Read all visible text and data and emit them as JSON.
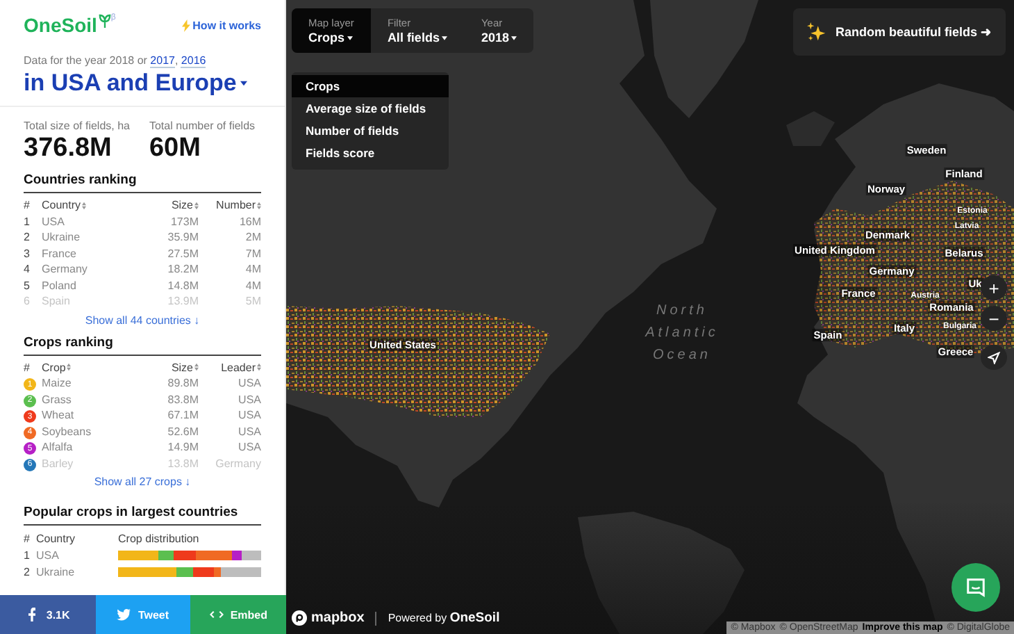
{
  "sidebar": {
    "logo": "OneSoil",
    "logo_mark": "β",
    "help_link": "How it works",
    "year_note": {
      "text": "Data for the year 2018 or",
      "links": [
        "2017",
        "2016"
      ],
      "separator": ","
    },
    "region_title": "in USA and Europe",
    "stats": [
      {
        "label": "Total size of fields, ha",
        "value": "376.8M"
      },
      {
        "label": "Total number of fields",
        "value": "60M"
      }
    ],
    "countries_ranking": {
      "title": "Countries ranking",
      "columns": [
        {
          "label": "#",
          "sortable": false
        },
        {
          "label": "Country",
          "sortable": true
        },
        {
          "label": "Size",
          "sortable": true
        },
        {
          "label": "Number",
          "sortable": true
        }
      ],
      "rows": [
        [
          "1",
          "USA",
          "173M",
          "16M"
        ],
        [
          "2",
          "Ukraine",
          "35.9M",
          "2M"
        ],
        [
          "3",
          "France",
          "27.5M",
          "7M"
        ],
        [
          "4",
          "Germany",
          "18.2M",
          "4M"
        ],
        [
          "5",
          "Poland",
          "14.8M",
          "4M"
        ],
        [
          "6",
          "Spain",
          "13.9M",
          "5M"
        ]
      ],
      "show_all": "Show all 44 countries ↓"
    },
    "crops_ranking": {
      "title": "Crops ranking",
      "columns": [
        {
          "label": "#",
          "sortable": false
        },
        {
          "label": "Crop",
          "sortable": true
        },
        {
          "label": "Size",
          "sortable": true
        },
        {
          "label": "Leader",
          "sortable": true
        }
      ],
      "rows": [
        {
          "rank": "1",
          "name": "Maize",
          "size": "89.8M",
          "leader": "USA",
          "color": "#f2b619"
        },
        {
          "rank": "2",
          "name": "Grass",
          "size": "83.8M",
          "leader": "USA",
          "color": "#5bbf4f"
        },
        {
          "rank": "3",
          "name": "Wheat",
          "size": "67.1M",
          "leader": "USA",
          "color": "#ef3a1c"
        },
        {
          "rank": "4",
          "name": "Soybeans",
          "size": "52.6M",
          "leader": "USA",
          "color": "#f06a24"
        },
        {
          "rank": "5",
          "name": "Alfalfa",
          "size": "14.9M",
          "leader": "USA",
          "color": "#b620c6"
        },
        {
          "rank": "6",
          "name": "Barley",
          "size": "13.8M",
          "leader": "Germany",
          "color": "#2477b8"
        }
      ],
      "show_all": "Show all 27 crops ↓"
    },
    "popular_crops": {
      "title": "Popular crops in largest countries",
      "columns": [
        "#",
        "Country",
        "Crop distribution"
      ],
      "rows": [
        {
          "rank": "1",
          "country": "USA"
        },
        {
          "rank": "2",
          "country": "Ukraine"
        }
      ]
    },
    "share": [
      {
        "kind": "facebook",
        "label": "3.1K"
      },
      {
        "kind": "twitter",
        "label": "Tweet"
      },
      {
        "kind": "embed",
        "label": "Embed"
      }
    ]
  },
  "map": {
    "controls": [
      {
        "label": "Map layer",
        "value": "Crops",
        "selected": true
      },
      {
        "label": "Filter",
        "value": "All fields",
        "selected": false
      },
      {
        "label": "Year",
        "value": "2018",
        "selected": false
      }
    ],
    "layer_menu": [
      {
        "label": "Crops",
        "selected": true
      },
      {
        "label": "Average size of fields",
        "selected": false
      },
      {
        "label": "Number of fields",
        "selected": false
      },
      {
        "label": "Fields score",
        "selected": false
      }
    ],
    "random_button": "Random beautiful fields ➜",
    "labels": [
      {
        "text": "United States",
        "kind": "country"
      },
      {
        "text": "North Atlantic Ocean",
        "kind": "ocean"
      },
      {
        "text": "Sweden",
        "kind": "country"
      },
      {
        "text": "Finland",
        "kind": "country"
      },
      {
        "text": "Norway",
        "kind": "country"
      },
      {
        "text": "Estonia",
        "kind": "small"
      },
      {
        "text": "Latvia",
        "kind": "small"
      },
      {
        "text": "Denmark",
        "kind": "country"
      },
      {
        "text": "United Kingdom",
        "kind": "country"
      },
      {
        "text": "Belarus",
        "kind": "country"
      },
      {
        "text": "Germany",
        "kind": "country"
      },
      {
        "text": "France",
        "kind": "country"
      },
      {
        "text": "Austria",
        "kind": "small"
      },
      {
        "text": "Uk",
        "kind": "country"
      },
      {
        "text": "Romania",
        "kind": "country"
      },
      {
        "text": "Bulgaria",
        "kind": "small"
      },
      {
        "text": "Italy",
        "kind": "country"
      },
      {
        "text": "Spain",
        "kind": "country"
      },
      {
        "text": "Greece",
        "kind": "country"
      }
    ],
    "zoom_buttons": [
      "+",
      "−"
    ],
    "logo": "mapbox",
    "powered_by": "Powered by",
    "powered_brand": "OneSoil",
    "attribution": [
      {
        "text": "© Mapbox",
        "kind": "plain"
      },
      {
        "text": "© OpenStreetMap",
        "kind": "plain"
      },
      {
        "text": "Improve this map",
        "kind": "link"
      },
      {
        "text": "© DigitalGlobe",
        "kind": "plain"
      }
    ]
  }
}
